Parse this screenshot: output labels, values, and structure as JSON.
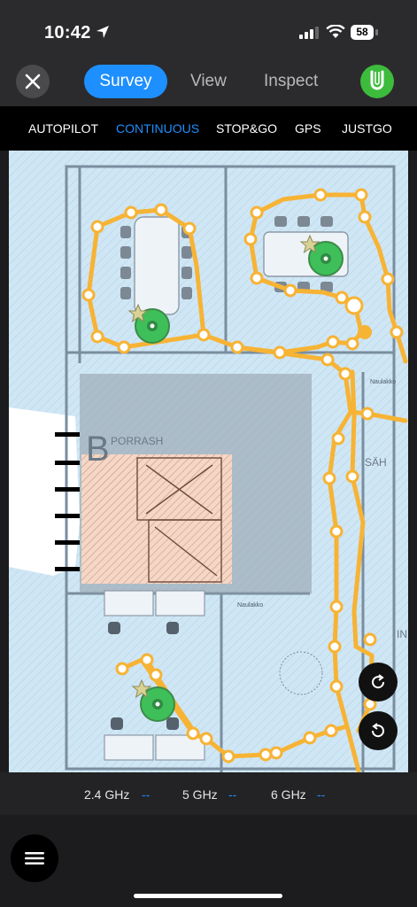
{
  "status_bar": {
    "time": "10:42",
    "battery": "58"
  },
  "nav": {
    "tabs": [
      {
        "label": "Survey",
        "active": true
      },
      {
        "label": "View",
        "active": false
      },
      {
        "label": "Inspect",
        "active": false
      }
    ]
  },
  "modes": [
    {
      "label": "AUTOPILOT",
      "active": false
    },
    {
      "label": "CONTINUOUS",
      "active": true
    },
    {
      "label": "STOP&GO",
      "active": false
    },
    {
      "label": "GPS",
      "active": false
    },
    {
      "label": "JUSTGO",
      "active": false
    }
  ],
  "map": {
    "labels": {
      "stairwell": "PORRASH",
      "storage": "Naulakko",
      "right_room": "SÄH",
      "stairwell_letter": "B",
      "edge_letters": "IN"
    },
    "colors": {
      "route": "#f7b334",
      "coverage": "#cfe6f5",
      "stair_hatch": "#e8b49e",
      "access_point": "#3fbf5a"
    }
  },
  "frequency_bar": {
    "bands": [
      {
        "label": "2.4 GHz",
        "value": "--"
      },
      {
        "label": "5 GHz",
        "value": "--"
      },
      {
        "label": "6 GHz",
        "value": "--"
      }
    ]
  },
  "icons": {
    "close": "close-icon",
    "u_logo": "magnet-u-icon",
    "redo": "redo-icon",
    "undo": "undo-icon",
    "menu": "hamburger-icon",
    "location": "location-arrow-icon"
  }
}
